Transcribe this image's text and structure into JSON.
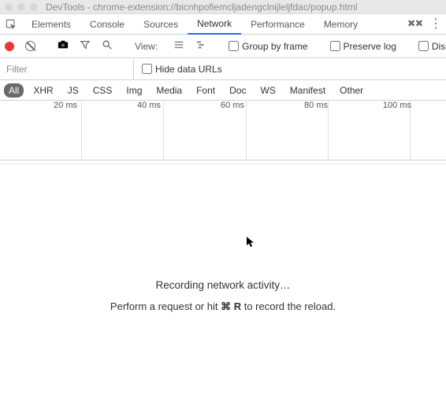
{
  "window": {
    "title": "DevTools - chrome-extension://bicnhpoflemcljadengclnijleljfdac/popup.html"
  },
  "tabs": {
    "items": [
      {
        "label": "Elements"
      },
      {
        "label": "Console"
      },
      {
        "label": "Sources"
      },
      {
        "label": "Network"
      },
      {
        "label": "Performance"
      },
      {
        "label": "Memory"
      }
    ],
    "active_index": 3
  },
  "toolbar": {
    "view_label": "View:",
    "group_by_frame": "Group by frame",
    "preserve_log": "Preserve log",
    "disable_cache": "Disable cache"
  },
  "filter_row": {
    "placeholder": "Filter",
    "value": "",
    "hide_data_urls": "Hide data URLs"
  },
  "types": {
    "items": [
      "All",
      "XHR",
      "JS",
      "CSS",
      "Img",
      "Media",
      "Font",
      "Doc",
      "WS",
      "Manifest",
      "Other"
    ],
    "active_index": 0
  },
  "timeline": {
    "ticks": [
      "20 ms",
      "40 ms",
      "60 ms",
      "80 ms",
      "100 ms"
    ]
  },
  "empty_state": {
    "line1": "Recording network activity…",
    "line2_a": "Perform a request or hit ",
    "line2_key": "⌘ R",
    "line2_b": " to record the reload."
  }
}
